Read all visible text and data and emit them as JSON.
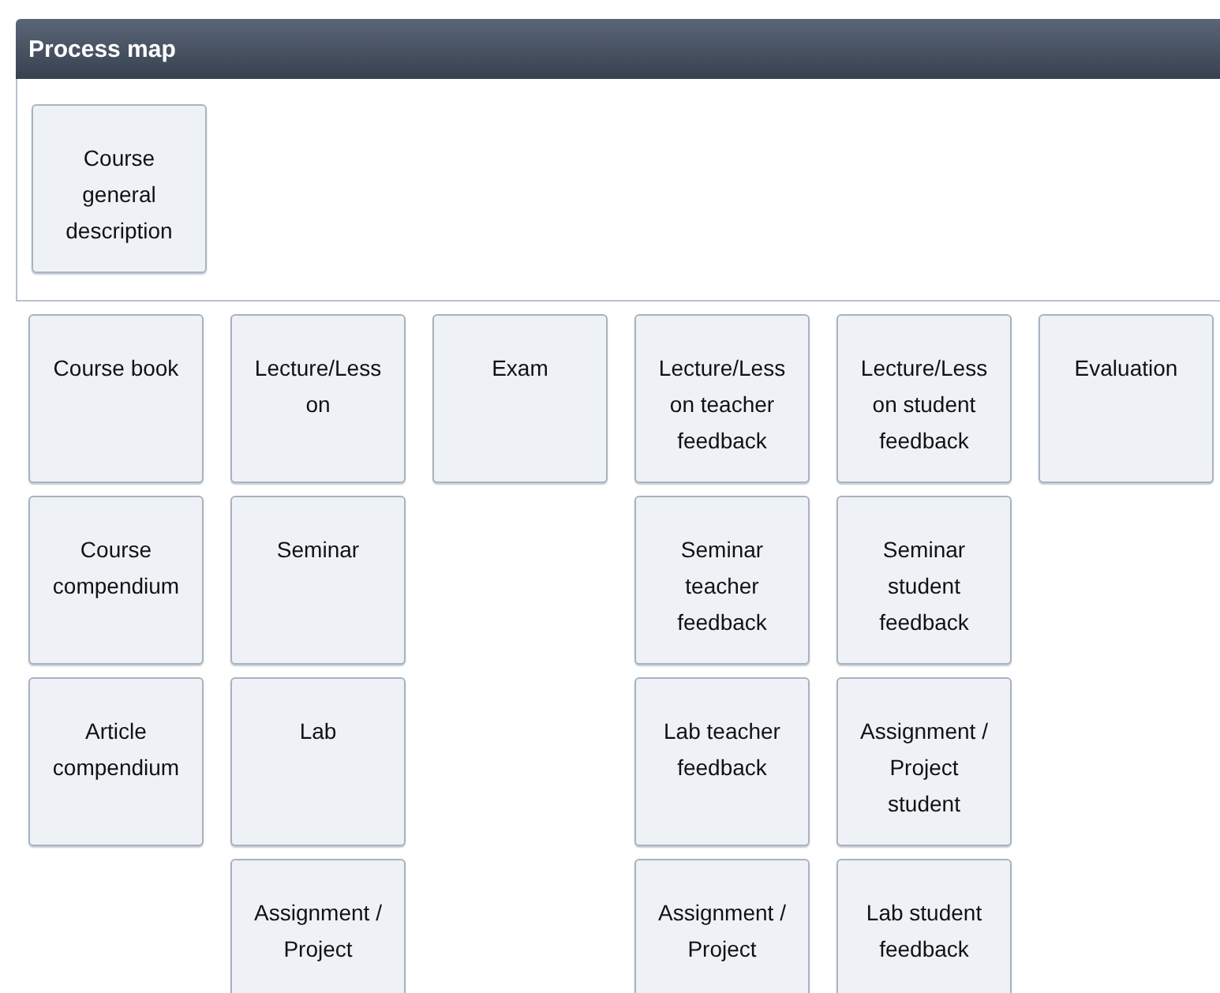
{
  "panel": {
    "title": "Process map"
  },
  "top_tiles": [
    "Course general description"
  ],
  "columns": [
    [
      "Course book",
      "Course compendium",
      "Article compendium"
    ],
    [
      "Lecture/Lesson",
      "Seminar",
      "Lab",
      "Assignment / Project"
    ],
    [
      "Exam"
    ],
    [
      "Lecture/Lesson teacher feedback",
      "Seminar teacher feedback",
      "Lab teacher feedback",
      "Assignment / Project"
    ],
    [
      "Lecture/Lesson student feedback",
      "Seminar student feedback",
      "Assignment / Project student",
      "Lab student feedback"
    ],
    [
      "Evaluation"
    ]
  ]
}
